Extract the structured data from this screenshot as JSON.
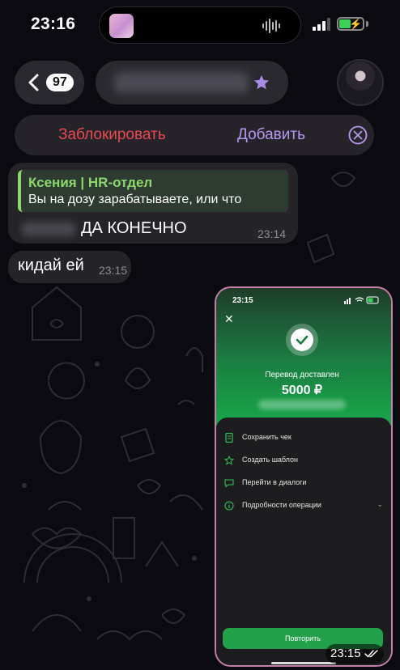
{
  "status_bar": {
    "time": "23:16"
  },
  "header": {
    "back_count": "97"
  },
  "action_bar": {
    "block_label": "Заблокировать",
    "add_label": "Добавить"
  },
  "messages": [
    {
      "reply_author": "Ксения  | HR-отдел",
      "reply_text": "Вы на дозу зарабатываете, или что",
      "text": "ДА КОНЕЧНО",
      "time": "23:14"
    },
    {
      "text": "кидай ей",
      "time": "23:15"
    }
  ],
  "photo": {
    "time": "23:15",
    "screenshot": {
      "status_time": "23:15",
      "title": "Перевод доставлен",
      "amount": "5000 ₽",
      "options": [
        {
          "label": "Сохранить чек",
          "icon": "receipt-icon"
        },
        {
          "label": "Создать шаблон",
          "icon": "star-outline-icon"
        },
        {
          "label": "Перейти в диалоги",
          "icon": "chat-icon"
        },
        {
          "label": "Подробности операции",
          "icon": "info-icon"
        }
      ],
      "repeat_label": "Повторить"
    }
  },
  "colors": {
    "block": "#e84a4f",
    "add": "#b799f0",
    "reply_accent": "#8bd96b",
    "bank_green": "#22a04a"
  }
}
